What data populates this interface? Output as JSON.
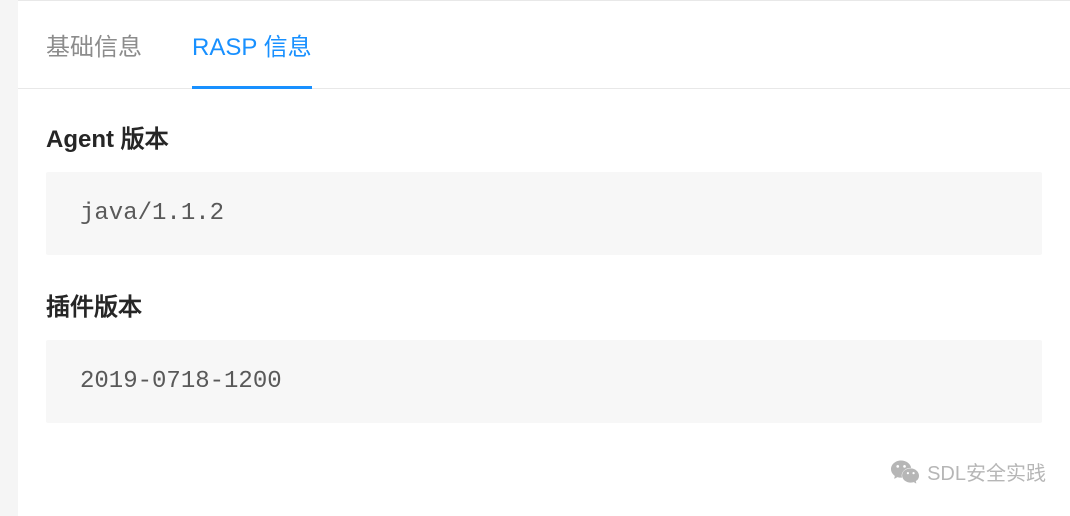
{
  "tabs": {
    "basic": {
      "label": "基础信息"
    },
    "rasp": {
      "label": "RASP 信息"
    }
  },
  "sections": {
    "agent_version": {
      "title": "Agent 版本",
      "value": "java/1.1.2"
    },
    "plugin_version": {
      "title": "插件版本",
      "value": "2019-0718-1200"
    }
  },
  "watermark": {
    "text": "SDL安全实践"
  }
}
